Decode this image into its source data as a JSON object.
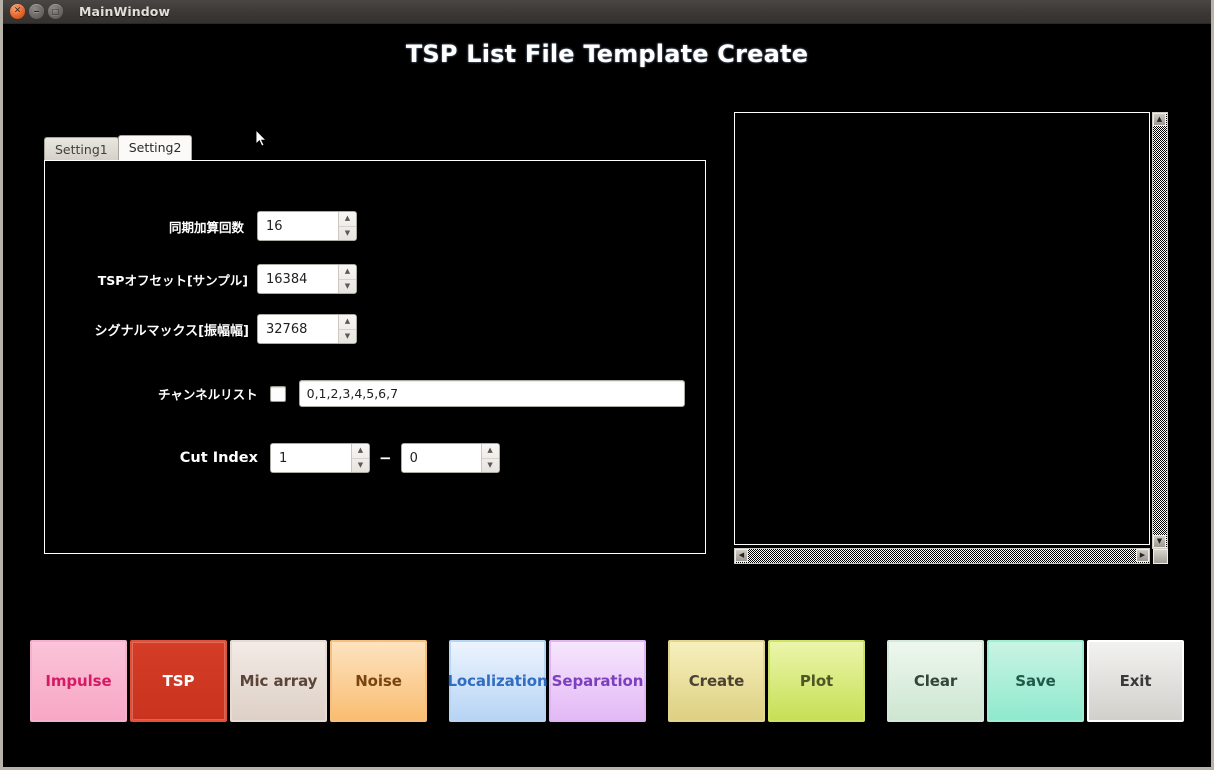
{
  "window": {
    "title": "MainWindow",
    "controls": [
      {
        "name": "close",
        "glyph": "✕"
      },
      {
        "name": "minimize",
        "glyph": "−"
      },
      {
        "name": "maximize",
        "glyph": "□"
      }
    ]
  },
  "header": {
    "title": "TSP List File Template Create"
  },
  "tabs": [
    {
      "label": "Setting1",
      "active": false
    },
    {
      "label": "Setting2",
      "active": true
    }
  ],
  "form": {
    "sync_add_count": {
      "label": "同期加算回数",
      "value": "16"
    },
    "tsp_offset": {
      "label": "TSPオフセット[サンプル]",
      "value": "16384"
    },
    "signal_max": {
      "label": "シグナルマックス[振幅幅]",
      "value": "32768"
    },
    "channel_list": {
      "label": "チャンネルリスト",
      "checked": false,
      "value": "0,1,2,3,4,5,6,7"
    },
    "cut_index": {
      "label": "Cut Index",
      "from": "1",
      "separator": "−",
      "to": "0"
    },
    "spinner_up": "▲",
    "spinner_down": "▼"
  },
  "canvas": {
    "scroll_up": "▲",
    "scroll_down": "▼",
    "scroll_left": "◀",
    "scroll_right": "▶"
  },
  "buttons": {
    "groups": [
      {
        "name": "signal-type",
        "items": [
          {
            "label": "Impulse",
            "bg": "#fbc4d8",
            "bg2": "#f7a7c4",
            "fg": "#d61a63",
            "border": "#f4b0cd",
            "selected": false
          },
          {
            "label": "TSP",
            "bg": "#d43c26",
            "bg2": "#c9341f",
            "fg": "#ffffff",
            "border": "#e2503a",
            "selected": true
          },
          {
            "label": "Mic array",
            "bg": "#f3ebe5",
            "bg2": "#ddd0c7",
            "fg": "#5b4438",
            "border": "#e6dbd2",
            "selected": false
          },
          {
            "label": "Noise",
            "bg": "#fde3c0",
            "bg2": "#f9bd71",
            "fg": "#7a4410",
            "border": "#f7bf7c",
            "selected": false
          }
        ]
      },
      {
        "name": "processing",
        "items": [
          {
            "label": "Localization",
            "bg": "#edf4fe",
            "bg2": "#b7d4f5",
            "fg": "#2f6ec0",
            "border": "#b9d5f4",
            "selected": false
          },
          {
            "label": "Separation",
            "bg": "#f6e6fc",
            "bg2": "#e3b9f6",
            "fg": "#7c3fbe",
            "border": "#dfb6f2",
            "selected": false
          }
        ]
      },
      {
        "name": "actions",
        "items": [
          {
            "label": "Create",
            "bg": "#f7f0bd",
            "bg2": "#ddd083",
            "fg": "#4b4330",
            "border": "#e2d58e",
            "selected": false
          },
          {
            "label": "Plot",
            "bg": "#ecf5ab",
            "bg2": "#c5e055",
            "fg": "#4e5626",
            "border": "#cbe463",
            "selected": false
          }
        ]
      },
      {
        "name": "file-ops",
        "items": [
          {
            "label": "Clear",
            "bg": "#eef7ee",
            "bg2": "#cde6d1",
            "fg": "#33463a",
            "border": "#d5e9d8",
            "selected": false
          },
          {
            "label": "Save",
            "bg": "#c9f4e4",
            "bg2": "#8fe9cd",
            "fg": "#1f5a49",
            "border": "#9eeed4",
            "selected": false
          },
          {
            "label": "Exit",
            "bg": "#f2f2f0",
            "bg2": "#d2d0cb",
            "fg": "#3a3a38",
            "border": "#ffffff",
            "selected": false
          }
        ]
      }
    ]
  }
}
